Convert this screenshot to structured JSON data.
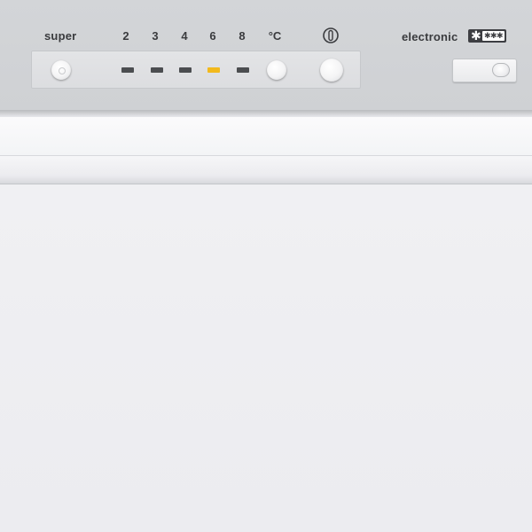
{
  "control_panel": {
    "super_label": "super",
    "temperature_scale": [
      "2",
      "3",
      "4",
      "6",
      "8"
    ],
    "unit_label": "°C",
    "active_setting": "6",
    "brand_label": "electronic",
    "freezer_rating": {
      "big_star": "✱",
      "small_stars": "✱✱✱"
    }
  },
  "colors": {
    "panel": "#d1d3d6",
    "led_off": "#4b4d50",
    "led_on": "#f2b91d",
    "door": "#eeeef1"
  },
  "icons": {
    "power": "power-icon",
    "freezer_rating": "four-star-freezer-icon"
  }
}
